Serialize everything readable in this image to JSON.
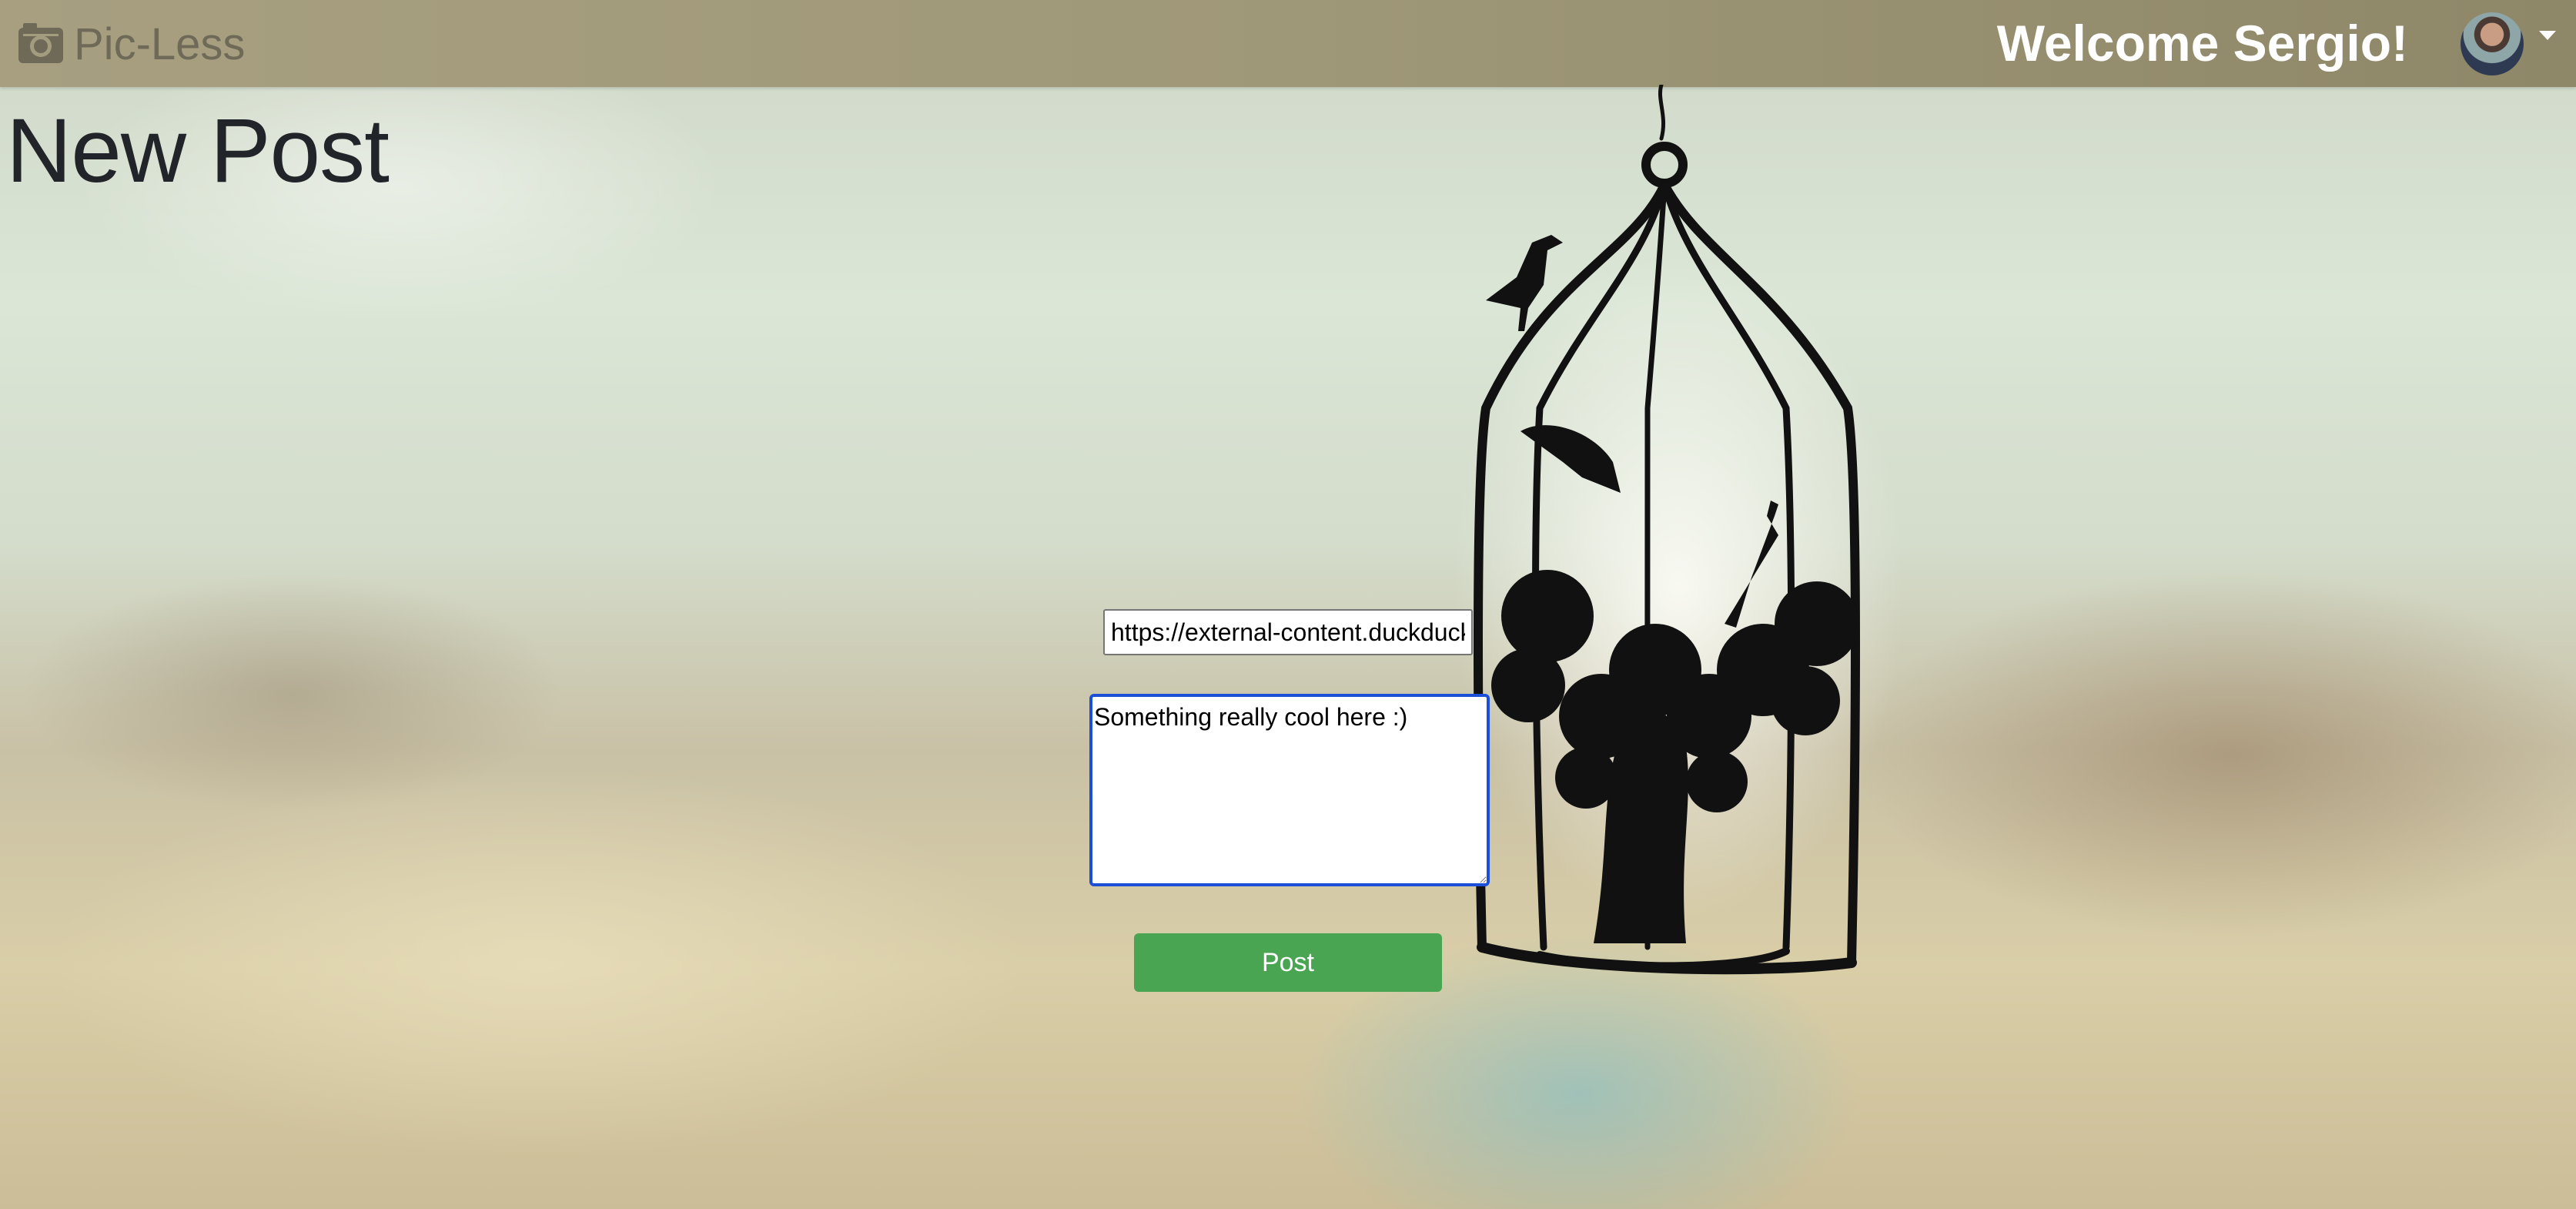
{
  "navbar": {
    "brand": "Pic-Less",
    "brand_icon": "camera-icon",
    "welcome": "Welcome Sergio!",
    "avatar_icon": "user-avatar",
    "menu_icon": "caret-down-icon"
  },
  "page": {
    "title": "New Post"
  },
  "form": {
    "image_url_value": "https://external-content.duckduckgo",
    "description_value": "Something really cool here :)",
    "post_label": "Post"
  },
  "colors": {
    "navbar": "#9f9878",
    "post_button": "#4aa552",
    "textarea_focus": "#1b4fd8"
  }
}
